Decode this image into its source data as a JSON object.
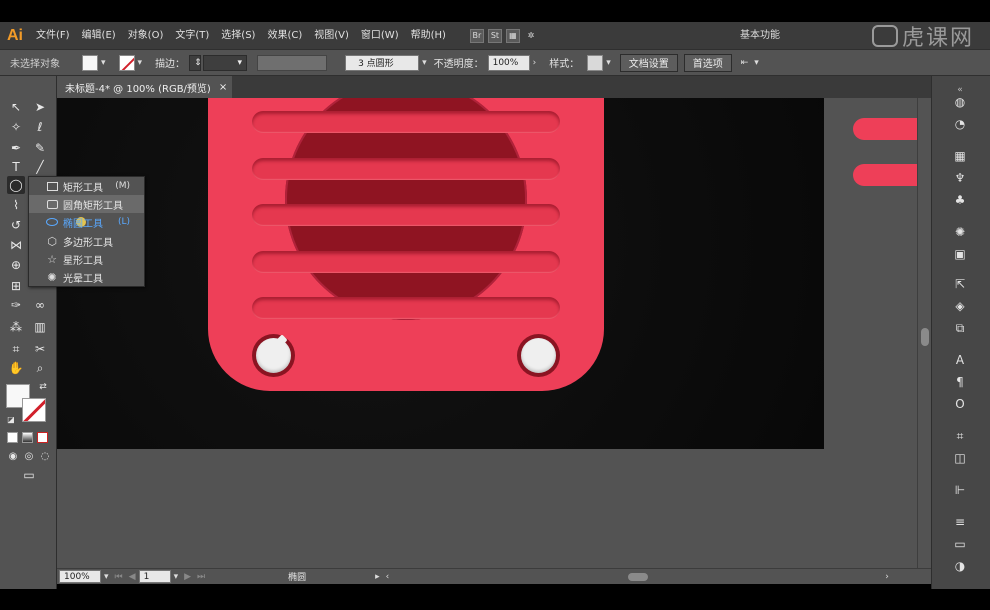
{
  "app": {
    "logo": "Ai",
    "workspace": "基本功能",
    "brand": "虎课网"
  },
  "menu": [
    "文件(F)",
    "编辑(E)",
    "对象(O)",
    "文字(T)",
    "选择(S)",
    "效果(C)",
    "视图(V)",
    "窗口(W)",
    "帮助(H)"
  ],
  "menu_icons": [
    "Br",
    "St"
  ],
  "control": {
    "no_selection": "未选择对象",
    "stroke_label": "描边：",
    "brush_value": "3 点圆形",
    "opacity_label": "不透明度：",
    "opacity_value": "100%",
    "style_label": "样式：",
    "doc_setup_btn": "文档设置",
    "prefs_btn": "首选项"
  },
  "document_tab": {
    "title": "未标题-4* @ 100% (RGB/预览)",
    "close": "×"
  },
  "flyout": {
    "items": [
      {
        "label": "矩形工具",
        "key": "(M)"
      },
      {
        "label": "圆角矩形工具",
        "key": ""
      },
      {
        "label": "椭圆工具",
        "key": "(L)"
      },
      {
        "label": "多边形工具",
        "key": ""
      },
      {
        "label": "星形工具",
        "key": ""
      },
      {
        "label": "光晕工具",
        "key": ""
      }
    ]
  },
  "status": {
    "zoom": "100%",
    "page": "1",
    "tool": "椭圆"
  },
  "colors": {
    "radio_red": "#ee3f58",
    "speaker_dark": "#8f1422",
    "selected_blue": "#5aa9ff"
  }
}
